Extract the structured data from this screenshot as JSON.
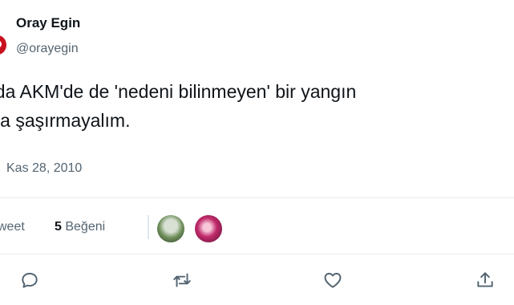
{
  "tweet": {
    "display_name": "Oray Egin",
    "handle": "@orayegin",
    "text_line1": "nda AKM'de de 'nedeni bilinmeyen' bir yangın",
    "text_line2": "rsa şaşırmayalım.",
    "timestamp": "Kas 28, 2010"
  },
  "stats": {
    "retweet_label_fragment": "weet",
    "likes_count": "5",
    "likes_label": "Beğeni"
  },
  "actions": [
    "reply-icon",
    "retweet-icon",
    "like-icon",
    "share-icon"
  ],
  "colors": {
    "text": "#0f1419",
    "secondary": "#536471",
    "divider": "#e6ecf0",
    "avatar": "#c8101e"
  }
}
